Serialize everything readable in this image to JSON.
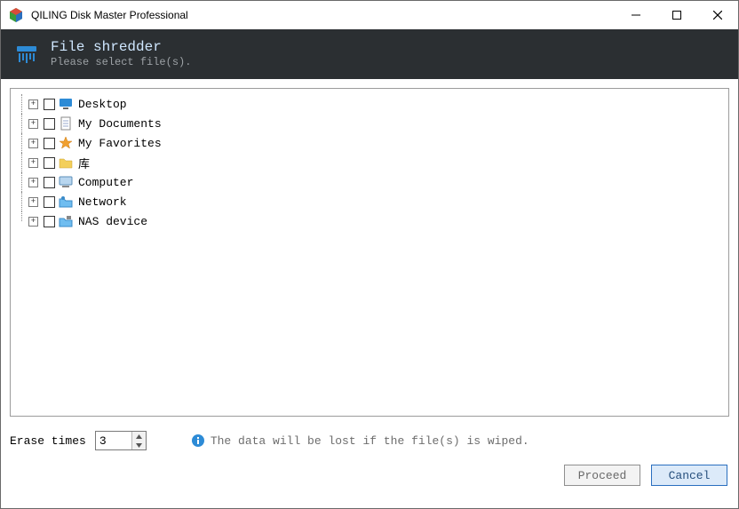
{
  "window": {
    "title": "QILING Disk Master Professional"
  },
  "header": {
    "title": "File shredder",
    "subtitle": "Please select file(s)."
  },
  "tree": {
    "items": [
      {
        "label": "Desktop",
        "icon": "desktop"
      },
      {
        "label": "My Documents",
        "icon": "document"
      },
      {
        "label": "My Favorites",
        "icon": "star"
      },
      {
        "label": "库",
        "icon": "folder"
      },
      {
        "label": "Computer",
        "icon": "computer"
      },
      {
        "label": "Network",
        "icon": "network"
      },
      {
        "label": "NAS device",
        "icon": "nas"
      }
    ]
  },
  "erase": {
    "label": "Erase times",
    "value": "3"
  },
  "info": {
    "text": "The data will be lost if the file(s) is wiped."
  },
  "buttons": {
    "proceed": "Proceed",
    "cancel": "Cancel"
  }
}
